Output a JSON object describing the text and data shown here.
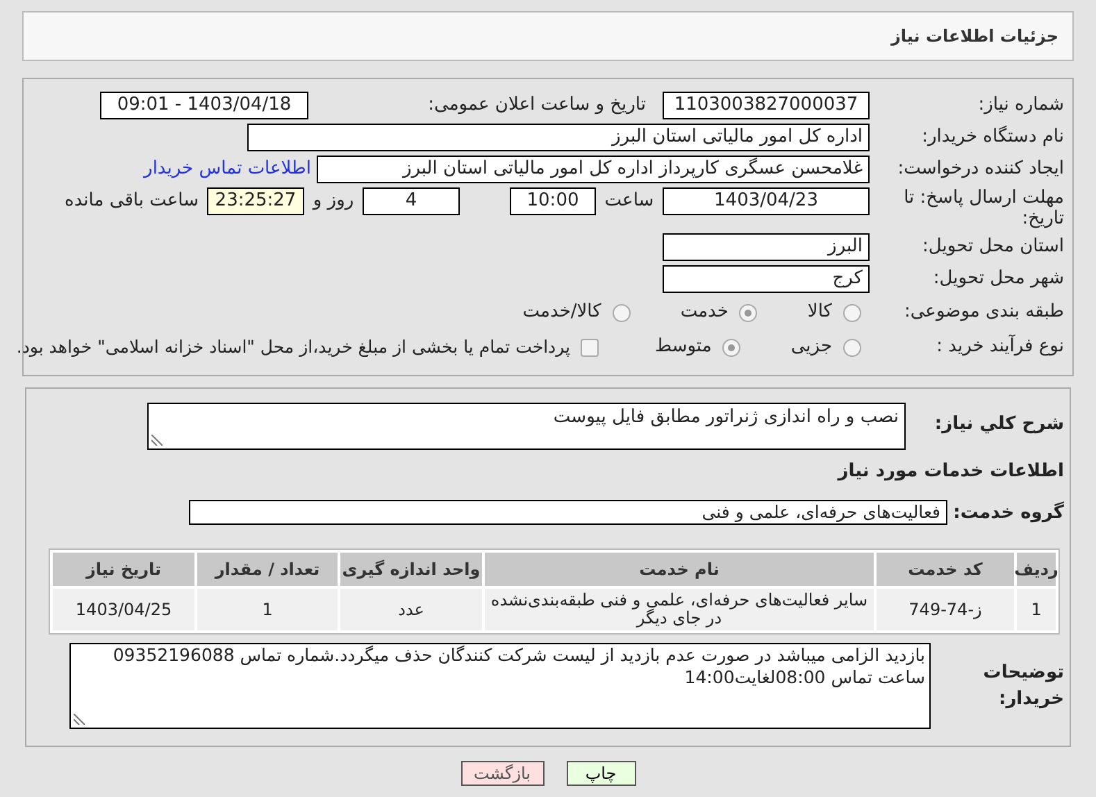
{
  "header": {
    "title": "جزئیات اطلاعات نیاز"
  },
  "need_number": {
    "label": "شماره نیاز:",
    "value": "1103003827000037"
  },
  "announce": {
    "label": "تاریخ و ساعت اعلان عمومی:",
    "value": "1403/04/18 - 09:01"
  },
  "buyer_org": {
    "label": "نام دستگاه خریدار:",
    "value": "اداره کل امور مالیاتی استان البرز"
  },
  "requester": {
    "label": "ایجاد کننده درخواست:",
    "value": "غلامحسن عسگری کارپرداز اداره کل امور مالیاتی استان البرز",
    "link": "اطلاعات تماس خریدار"
  },
  "deadline": {
    "label": "مهلت ارسال پاسخ: تا تاریخ:",
    "date": "1403/04/23",
    "time_label": "ساعت",
    "time": "10:00",
    "days": "4",
    "days_label": "روز و",
    "remaining": "23:25:27",
    "remaining_label": "ساعت باقی مانده"
  },
  "province": {
    "label": "استان محل تحویل:",
    "value": "البرز"
  },
  "city": {
    "label": "شهر محل تحویل:",
    "value": "کرج"
  },
  "category": {
    "label": "طبقه بندی موضوعی:",
    "options": [
      {
        "label": "کالا",
        "selected": false
      },
      {
        "label": "خدمت",
        "selected": true
      },
      {
        "label": "کالا/خدمت",
        "selected": false
      }
    ]
  },
  "purchase_type": {
    "label": "نوع فرآیند خرید :",
    "options": [
      {
        "label": "جزیی",
        "selected": false
      },
      {
        "label": "متوسط",
        "selected": true
      }
    ],
    "payment": {
      "label": "پرداخت تمام یا بخشی از مبلغ خرید،از محل \"اسناد خزانه اسلامی\" خواهد بود.",
      "checked": false
    }
  },
  "description": {
    "label": "شرح کلي نیاز:",
    "value": "نصب و راه اندازی ژنراتور مطابق فایل پیوست"
  },
  "services_title": "اطلاعات خدمات مورد نیاز",
  "service_group": {
    "label": "گروه خدمت:",
    "value": "فعالیت‌های حرفه‌ای، علمی و فنی"
  },
  "table": {
    "columns": [
      "ردیف",
      "کد خدمت",
      "نام خدمت",
      "واحد اندازه گیری",
      "تعداد / مقدار",
      "تاریخ نیاز"
    ],
    "rows": [
      [
        "1",
        "ز-74-749",
        "سایر فعالیت‌های حرفه‌ای، علمی و فنی طبقه‌بندی‌نشده در جای دیگر",
        "عدد",
        "1",
        "1403/04/25"
      ]
    ]
  },
  "buyer_notes": {
    "label": "توضیحات خریدار:",
    "value": "بازدید الزامی میباشد در صورت عدم بازدید از لیست شرکت کنندگان حذف میگردد.شماره تماس 09352196088 ساعت تماس 08:00لغایت14:00"
  },
  "buttons": [
    {
      "label": "چاپ",
      "kind": "print"
    },
    {
      "label": "بازگشت",
      "kind": "back"
    }
  ]
}
